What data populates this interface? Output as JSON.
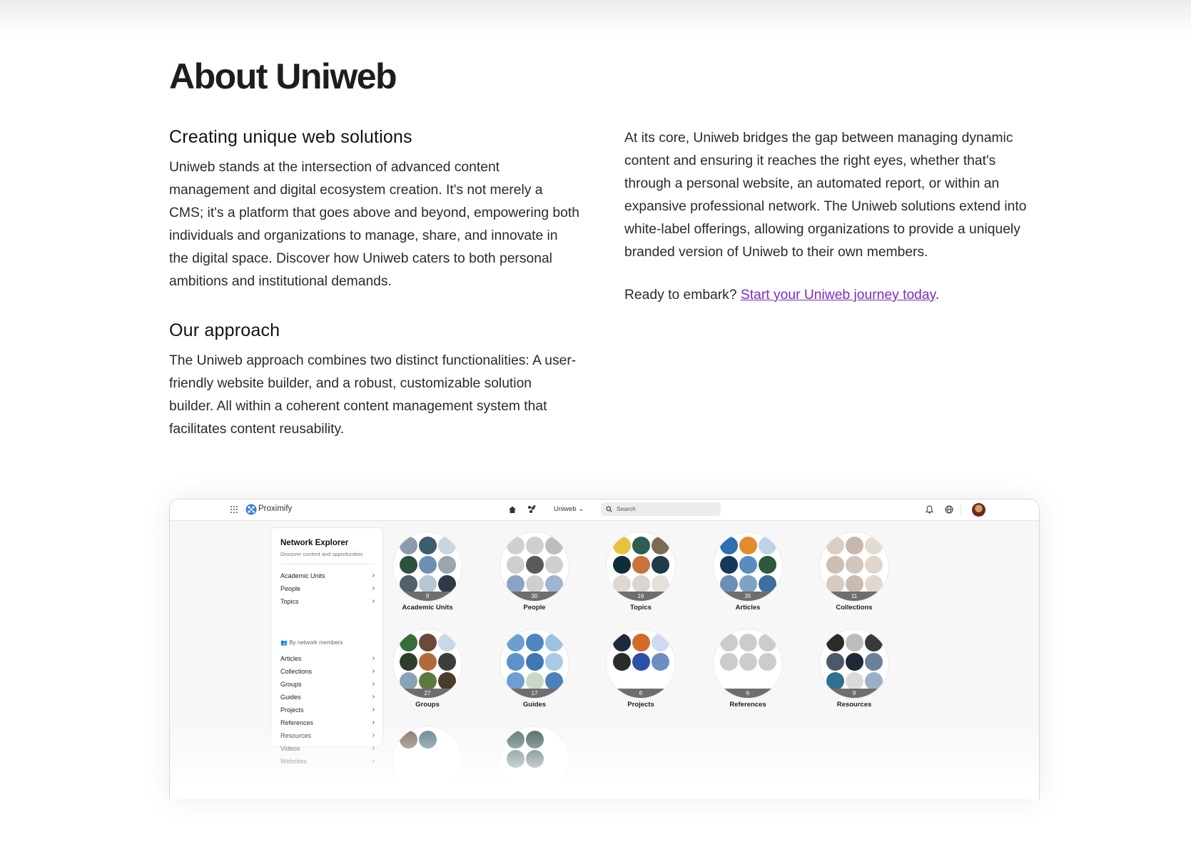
{
  "page": {
    "title": "About Uniweb",
    "section1": {
      "heading": "Creating unique web solutions",
      "body": "Uniweb stands at the intersection of advanced content management and digital ecosystem creation. It's not merely a CMS; it's a platform that goes above and beyond, empowering both individuals and organizations to manage, share, and innovate in the digital space. Discover how Uniweb caters to both personal ambitions and institutional demands."
    },
    "section2": {
      "heading": "Our approach",
      "body": "The Uniweb approach combines two distinct functionalities: A user-friendly website builder, and a robust, customizable solution builder. All within a coherent content management system that facilitates content reusability."
    },
    "right": {
      "body": "At its core, Uniweb bridges the gap between managing dynamic content and ensuring it reaches the right eyes, whether that's through a personal website, an automated report, or within an expansive professional network. The Uniweb solutions extend into white-label offerings, allowing organizations to provide a uniquely branded version of Uniweb to their own members.",
      "cta_prefix": "Ready to embark? ",
      "cta_link": "Start your Uniweb journey today",
      "cta_suffix": "."
    },
    "link_color": "#7b2cbf"
  },
  "app": {
    "brand": "Proximify",
    "selector": "Uniweb",
    "search_placeholder": "Search",
    "icons": [
      "apps-grid-icon",
      "proximify-logo-icon",
      "home-icon",
      "network-icon",
      "chevron-down-icon",
      "search-icon",
      "bell-icon",
      "globe-icon"
    ],
    "sidebar": {
      "title": "Network Explorer",
      "subtitle": "Discover content and opportunities",
      "items_top": [
        "Academic Units",
        "People",
        "Topics"
      ],
      "group_label": "By network members",
      "items_bottom": [
        "Articles",
        "Collections",
        "Groups",
        "Guides",
        "Projects",
        "References",
        "Resources",
        "Videos",
        "Websites"
      ]
    },
    "tiles": [
      {
        "label": "Academic Units",
        "count": "9"
      },
      {
        "label": "People",
        "count": "30"
      },
      {
        "label": "Topics",
        "count": "16"
      },
      {
        "label": "Articles",
        "count": "35"
      },
      {
        "label": "Collections",
        "count": "11"
      },
      {
        "label": "Groups",
        "count": "27"
      },
      {
        "label": "Guides",
        "count": "17"
      },
      {
        "label": "Projects",
        "count": "6"
      },
      {
        "label": "References",
        "count": "6"
      },
      {
        "label": "Resources",
        "count": "9"
      },
      {
        "label": "",
        "count": ""
      },
      {
        "label": "",
        "count": ""
      }
    ]
  }
}
